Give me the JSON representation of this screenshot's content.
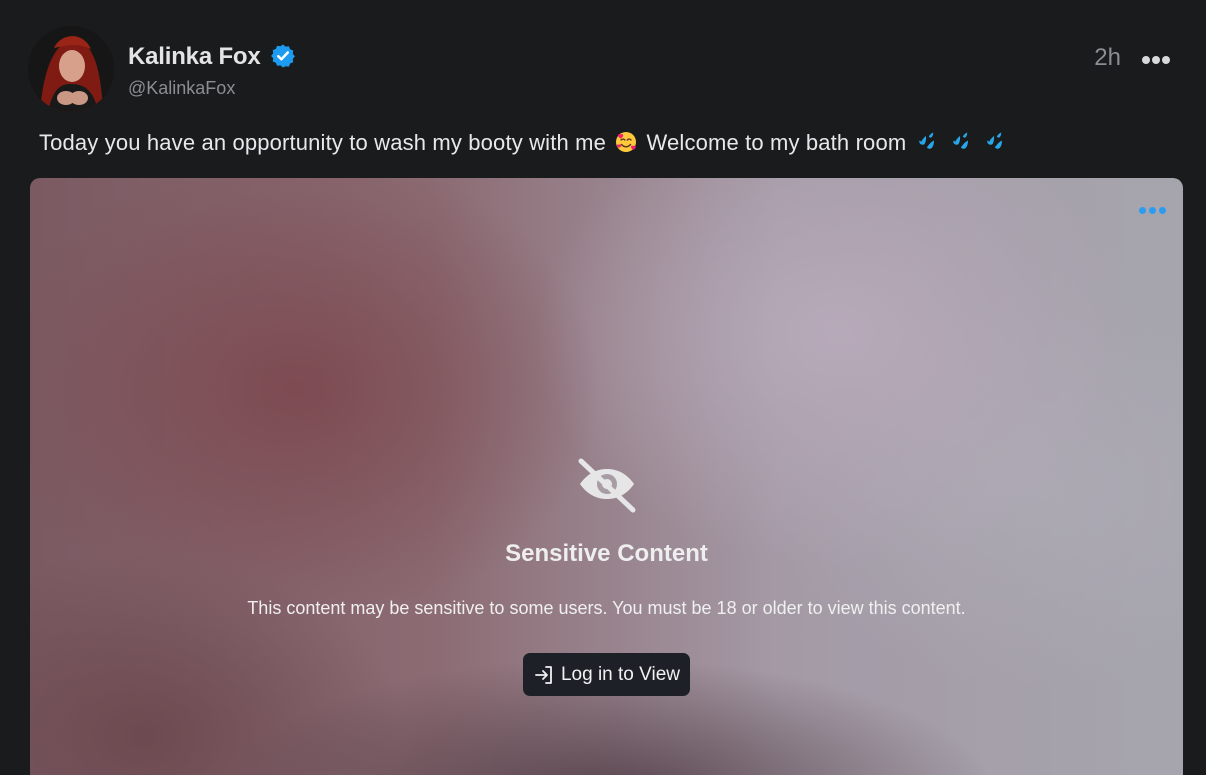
{
  "author": {
    "display_name": "Kalinka Fox",
    "handle": "@KalinkaFox",
    "verified_icon": "verified-badge-icon"
  },
  "post": {
    "timestamp": "2h",
    "text_before": "Today you have an opportunity to wash my booty with me",
    "text_middle": "Welcome to my bath room",
    "emojis": [
      "smiling-face-with-hearts",
      "sweat-droplets",
      "sweat-droplets",
      "sweat-droplets"
    ]
  },
  "sensitive": {
    "title": "Sensitive Content",
    "description": "This content may be sensitive to some users. You must be 18 or older to view this content.",
    "login_label": "Log in to View"
  },
  "colors": {
    "background": "#1a1b1d",
    "accent": "#2d9cf0",
    "verified": "#1d9bf0",
    "muted": "#8a8d91"
  }
}
